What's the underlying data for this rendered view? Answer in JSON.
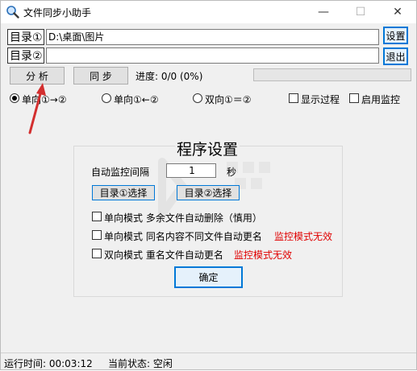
{
  "app": {
    "title": "文件同步小助手"
  },
  "window_controls": {
    "minimize": "—",
    "maximize": "☐",
    "close": "✕"
  },
  "dir1": {
    "label": "目录①",
    "path": "D:\\桌面\\图片"
  },
  "dir2": {
    "label": "目录②",
    "path": ""
  },
  "buttons": {
    "settings": "设置",
    "exit": "退出",
    "analyze": "分 析",
    "sync": "同 步",
    "confirm": "确定",
    "select_dir1": "目录①选择",
    "select_dir2": "目录②选择"
  },
  "progress": {
    "label": "进度: 0/0 (0%)",
    "fraction": 0
  },
  "modes": {
    "oneway_right": "单向①→②",
    "oneway_left": "单向①←②",
    "twoway": "双向①＝②",
    "selected": "oneway_right"
  },
  "options": {
    "show_process": "显示过程",
    "enable_monitor": "启用监控"
  },
  "settings_panel": {
    "title": "程序设置",
    "interval_label": "自动监控间隔",
    "interval_value": "1",
    "interval_unit": "秒",
    "opt1": "单向模式 多余文件自动删除（慎用）",
    "opt2": "单向模式 同名内容不同文件自动更名",
    "opt2_note": "监控模式无效",
    "opt3": "双向模式 重名文件自动更名",
    "opt3_note": "监控模式无效"
  },
  "status": {
    "runtime": "运行时间: 00:03:12",
    "state": "当前状态: 空闲"
  },
  "colors": {
    "accent": "#0078d7",
    "warning": "#e00000",
    "annotation_arrow": "#d32f2f"
  }
}
